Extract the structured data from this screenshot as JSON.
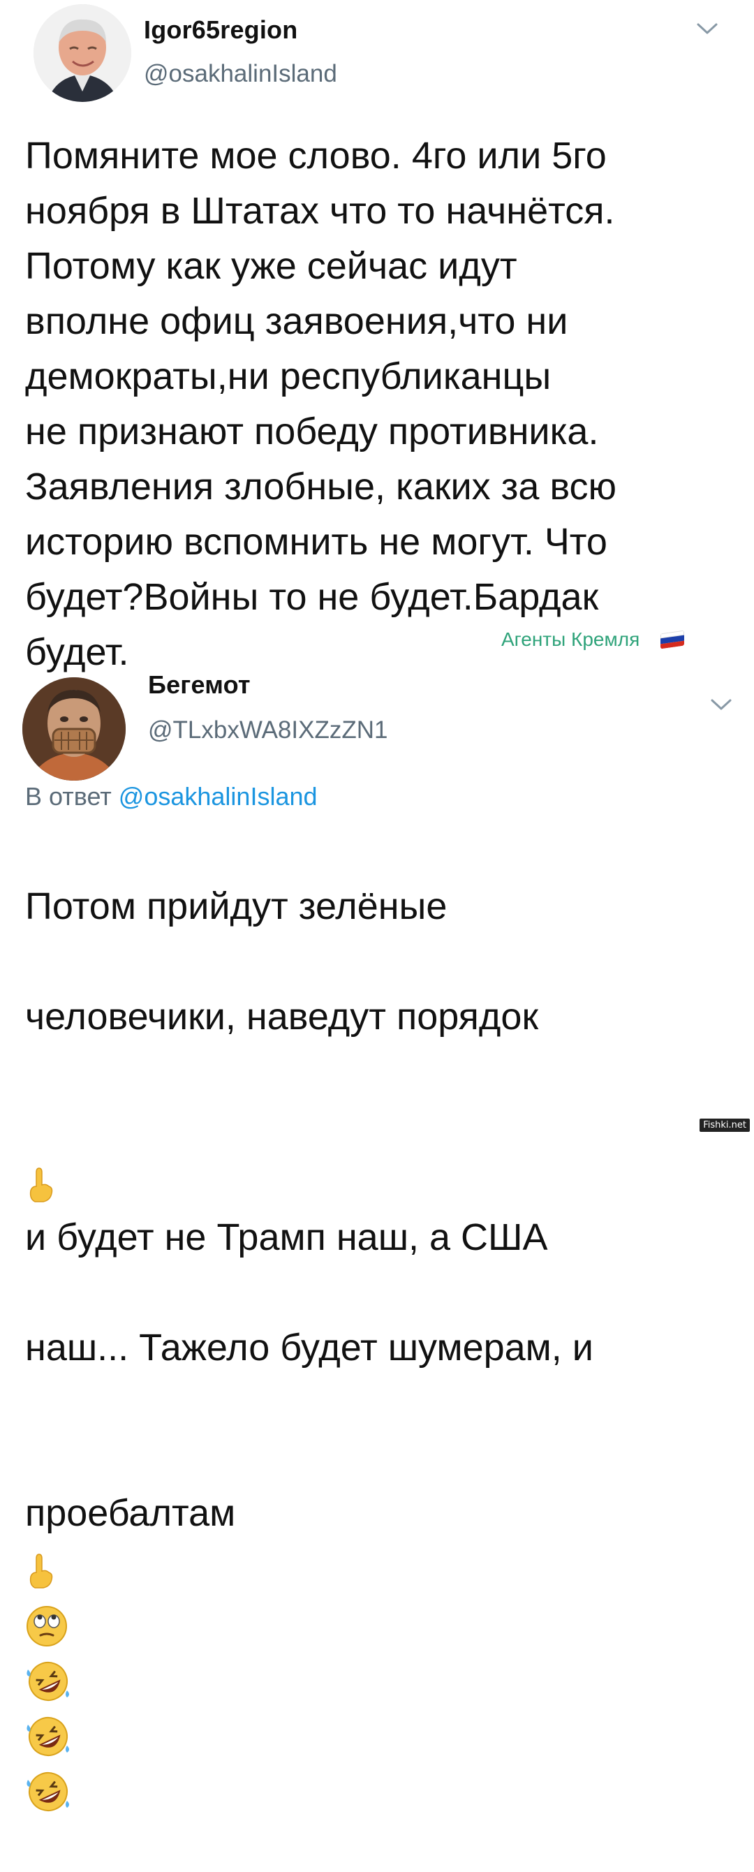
{
  "tweets": [
    {
      "name": "Igor65region",
      "handle": "@osakhalinIsland",
      "text": "Помяните мое слово. 4го или 5го\nноября в Штатах что то начнётся.\nПотому как уже сейчас идут\nвполне офиц заявоения,что ни\nдемократы,ни республиканцы\nне признают победу противника.\nЗаявления злобные, каких за всю\nисторию вспомнить не могут. Что\nбудет?Войны то не будет.Бардак\nбудет.",
      "chevron_icon": "chevron-down-icon"
    },
    {
      "name": "Бегемот",
      "handle": "@TLxbxWA8IXZzZN1",
      "reply_prefix": "В ответ",
      "reply_mention": "@osakhalinIsland",
      "text_lines": [
        "Потом прийдут зелёные",
        "человечики, наведут порядок",
        "и будет не Трамп наш, а США",
        "наш... Тажело будет шумерам, и",
        "проебалтам"
      ],
      "chevron_icon": "chevron-down-icon",
      "emojis": [
        "pointing-up-emoji",
        "rolling-eyes-emoji",
        "rofl-emoji",
        "rofl-emoji",
        "rofl-emoji"
      ]
    }
  ],
  "watermark": {
    "text": "Агенты Кремля",
    "flag_icon": "russia-flag-icon",
    "color": "#2fa37a"
  },
  "site_mark": "Fishki.net",
  "colors": {
    "handle": "#5b6b78",
    "mention": "#1b95e0",
    "text": "#111111"
  }
}
